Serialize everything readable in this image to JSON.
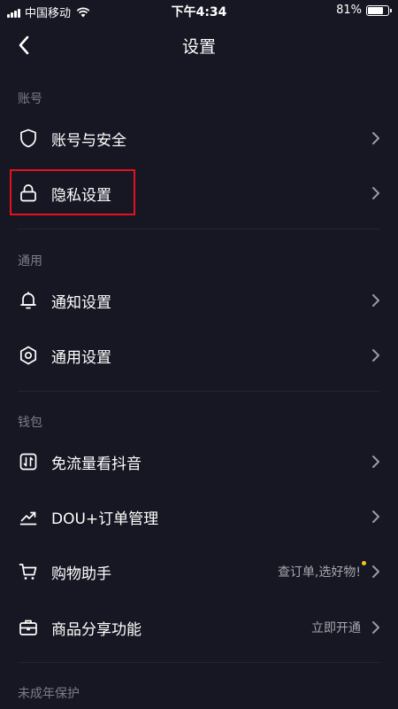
{
  "status_bar": {
    "carrier": "中国移动",
    "time": "下午4:34",
    "battery_percent": "81%",
    "battery_level": 0.81
  },
  "nav": {
    "title": "设置",
    "back_icon": "chevron-left-icon"
  },
  "sections": {
    "account": {
      "header": "账号",
      "items": [
        {
          "label": "账号与安全",
          "icon": "shield-icon"
        },
        {
          "label": "隐私设置",
          "icon": "lock-icon",
          "highlighted": true
        }
      ]
    },
    "general": {
      "header": "通用",
      "items": [
        {
          "label": "通知设置",
          "icon": "bell-icon"
        },
        {
          "label": "通用设置",
          "icon": "gear-icon"
        }
      ]
    },
    "wallet": {
      "header": "钱包",
      "items": [
        {
          "label": "免流量看抖音",
          "icon": "data-plan-icon"
        },
        {
          "label": "DOU+订单管理",
          "icon": "trend-icon"
        },
        {
          "label": "购物助手",
          "icon": "cart-icon",
          "extra": "查订单,选好物!",
          "badge_dot": true
        },
        {
          "label": "商品分享功能",
          "icon": "briefcase-icon",
          "extra": "立即开通"
        }
      ]
    },
    "minor": {
      "header": "未成年保护"
    }
  },
  "colors": {
    "background": "#161722",
    "text_primary": "#ffffff",
    "text_secondary": "#7c7d85",
    "highlight_border": "#e3121e",
    "badge_dot": "#f5c419"
  }
}
